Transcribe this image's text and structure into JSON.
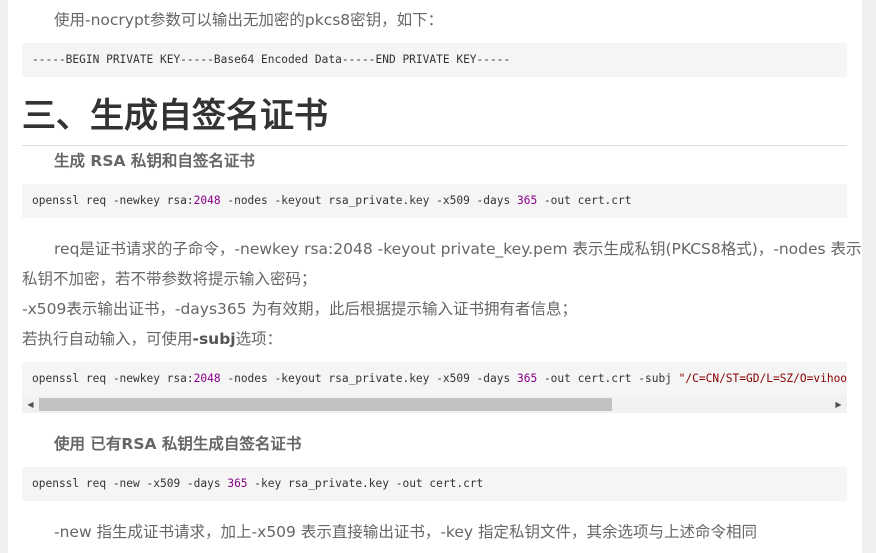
{
  "intro": {
    "text": "使用-nocrypt参数可以输出无加密的pkcs8密钥，如下："
  },
  "code1": {
    "text": "-----BEGIN PRIVATE KEY-----Base64 Encoded Data-----END PRIVATE KEY-----"
  },
  "section": {
    "title": "三、生成自签名证书"
  },
  "sub1": {
    "title": "生成 RSA 私钥和自签名证书"
  },
  "code2": {
    "p1": "openssl req -newkey rsa:",
    "n1": "2048",
    "p2": " -nodes -keyout rsa_private.key -x509 -days ",
    "n2": "365",
    "p3": " -out cert.crt"
  },
  "para1": {
    "line1": "req是证书请求的子命令，-newkey rsa:2048 -keyout private_key.pem 表示生成私钥(PKCS8格式)，-nodes 表示",
    "line2": "私钥不加密，若不带参数将提示输入密码；",
    "line3": "-x509表示输出证书，-days365 为有效期，此后根据提示输入证书拥有者信息；",
    "line4_pre": "若执行自动输入，可使用",
    "line4_bold": "-subj",
    "line4_post": "选项："
  },
  "code3": {
    "p1": "openssl req -newkey rsa:",
    "n1": "2048",
    "p2": " -nodes -keyout rsa_private.key -x509 -days ",
    "n2": "365",
    "p3": " -out cert.crt -subj ",
    "s1": "\"/C=CN/ST=GD/L=SZ/O=vihoo"
  },
  "sub2": {
    "title": "使用 已有RSA 私钥生成自签名证书"
  },
  "code4": {
    "p1": "openssl req -new -x509 -days ",
    "n1": "365",
    "p2": " -key rsa_private.key -out cert.crt"
  },
  "para2": {
    "text": "-new 指生成证书请求，加上-x509 表示直接输出证书，-key 指定私钥文件，其余选项与上述命令相同"
  },
  "scrollbar": {
    "left_arrow": "◀",
    "right_arrow": "▶",
    "position": 0.0
  }
}
